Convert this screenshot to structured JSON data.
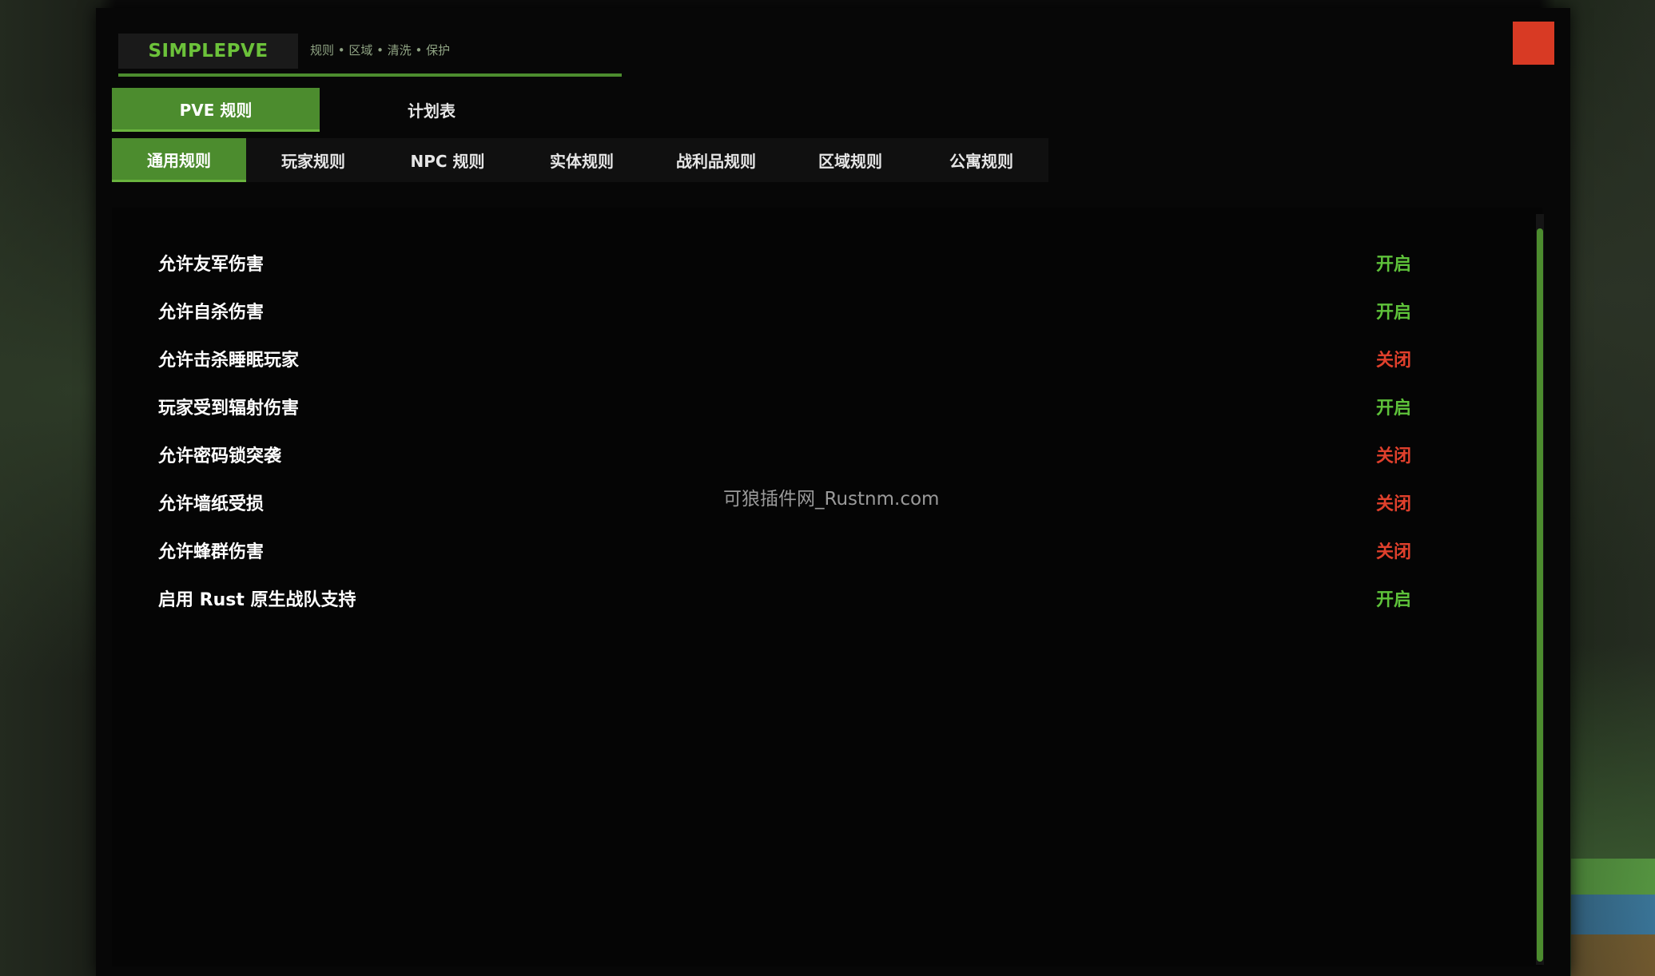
{
  "colors": {
    "accent": "#4c8c2e",
    "on": "#5ec23a",
    "off": "#e0402c",
    "close": "#d83a24"
  },
  "header": {
    "logo": "SIMPLEPVE",
    "subtitle": "规则 • 区域 • 清洗 • 保护"
  },
  "close_button": {
    "icon": "close-icon"
  },
  "main_tabs": [
    {
      "label": "PVE 规则",
      "active": true
    },
    {
      "label": "计划表",
      "active": false
    }
  ],
  "sub_tabs": [
    {
      "label": "通用规则",
      "active": true
    },
    {
      "label": "玩家规则",
      "active": false
    },
    {
      "label": "NPC 规则",
      "active": false
    },
    {
      "label": "实体规则",
      "active": false
    },
    {
      "label": "战利品规则",
      "active": false
    },
    {
      "label": "区域规则",
      "active": false
    },
    {
      "label": "公寓规则",
      "active": false
    }
  ],
  "rules": [
    {
      "label": "允许友军伤害",
      "value": "开启",
      "enabled": true
    },
    {
      "label": "允许自杀伤害",
      "value": "开启",
      "enabled": true
    },
    {
      "label": "允许击杀睡眠玩家",
      "value": "关闭",
      "enabled": false
    },
    {
      "label": "玩家受到辐射伤害",
      "value": "开启",
      "enabled": true
    },
    {
      "label": "允许密码锁突袭",
      "value": "关闭",
      "enabled": false
    },
    {
      "label": "允许墙纸受损",
      "value": "关闭",
      "enabled": false
    },
    {
      "label": "允许蜂群伤害",
      "value": "关闭",
      "enabled": false
    },
    {
      "label": "启用 Rust 原生战队支持",
      "value": "开启",
      "enabled": true
    }
  ],
  "watermark": "可狼插件网_Rustnm.com"
}
